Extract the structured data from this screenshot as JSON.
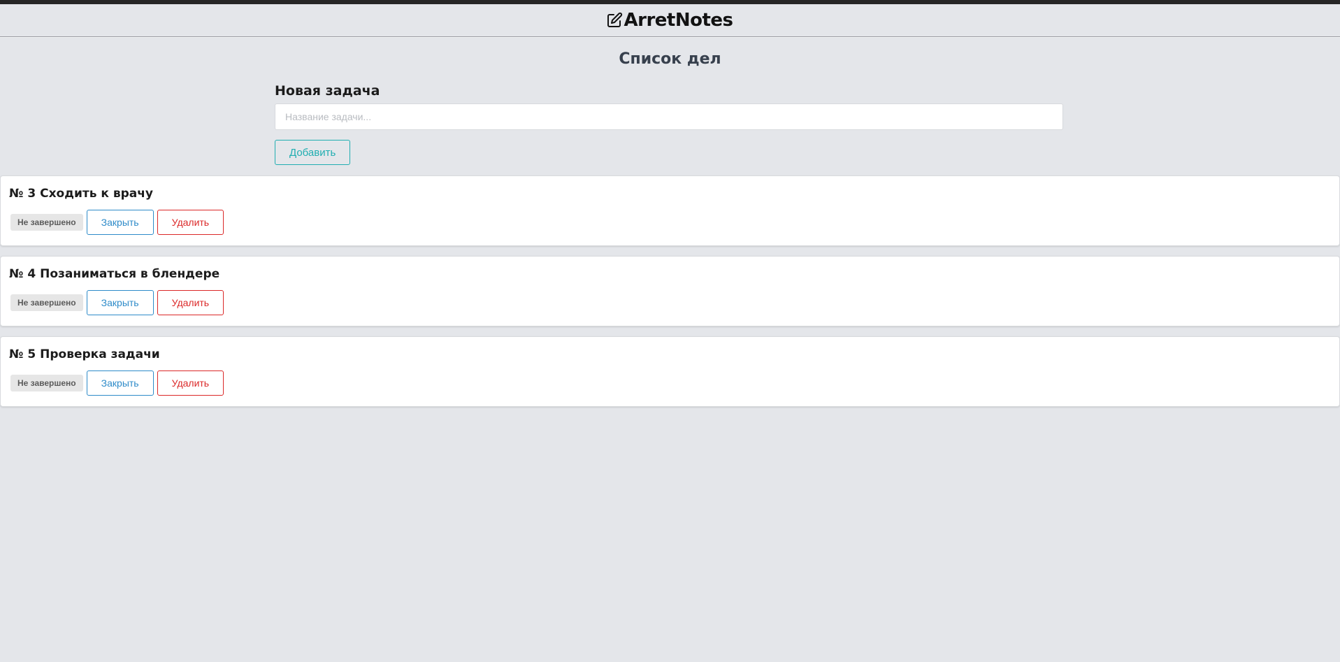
{
  "header": {
    "brand": "ArretNotes",
    "brand_icon": "edit-icon"
  },
  "page": {
    "title": "Список дел"
  },
  "new_task": {
    "label": "Новая задача",
    "input_value": "",
    "input_placeholder": "Название задачи...",
    "add_label": "Добавить"
  },
  "tasks": [
    {
      "title": "№ 3 Сходить к врачу",
      "status": "Не завершено",
      "close_label": "Закрыть",
      "delete_label": "Удалить"
    },
    {
      "title": "№ 4 Позаниматься в блендере",
      "status": "Не завершено",
      "close_label": "Закрыть",
      "delete_label": "Удалить"
    },
    {
      "title": "№ 5 Проверка задачи",
      "status": "Не завершено",
      "close_label": "Закрыть",
      "delete_label": "Удалить"
    }
  ],
  "colors": {
    "background": "#e4e6ea",
    "add_button": "#21aeb1",
    "close_button": "#2e8bc9",
    "delete_button": "#db2828",
    "badge_background": "#e6e6e6"
  }
}
